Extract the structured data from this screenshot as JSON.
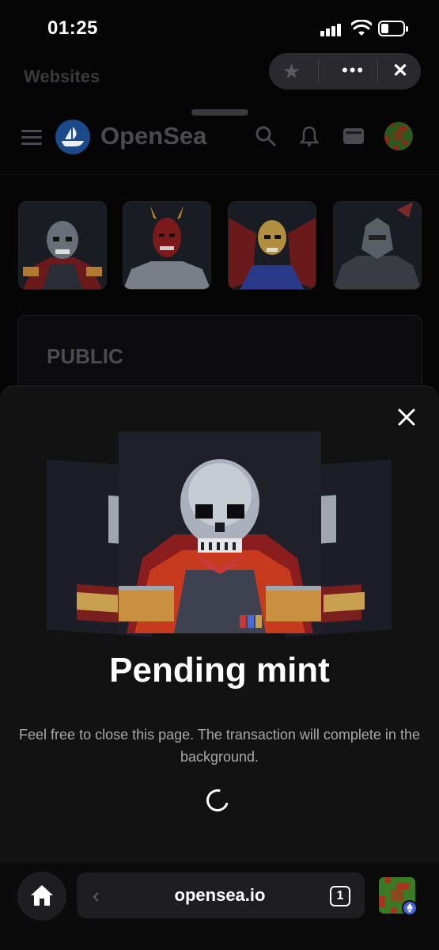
{
  "status_bar": {
    "time": "01:25"
  },
  "browser_header": {
    "title": "Websites"
  },
  "site_nav": {
    "brand": "OpenSea"
  },
  "collection": {
    "phase_label": "PUBLIC"
  },
  "modal": {
    "title": "Pending mint",
    "description": "Feel free to close this page. The transaction will complete in the background."
  },
  "address_bar": {
    "url": "opensea.io",
    "tab_count": "1"
  },
  "colors": {
    "accent": "#2081e2",
    "sheet_bg": "#121212",
    "page_bg": "#050505"
  },
  "icons": [
    "star-icon",
    "more-icon",
    "close-icon",
    "menu-icon",
    "search-icon",
    "bell-icon",
    "wallet-icon",
    "home-icon",
    "back-icon",
    "spinner-icon"
  ]
}
